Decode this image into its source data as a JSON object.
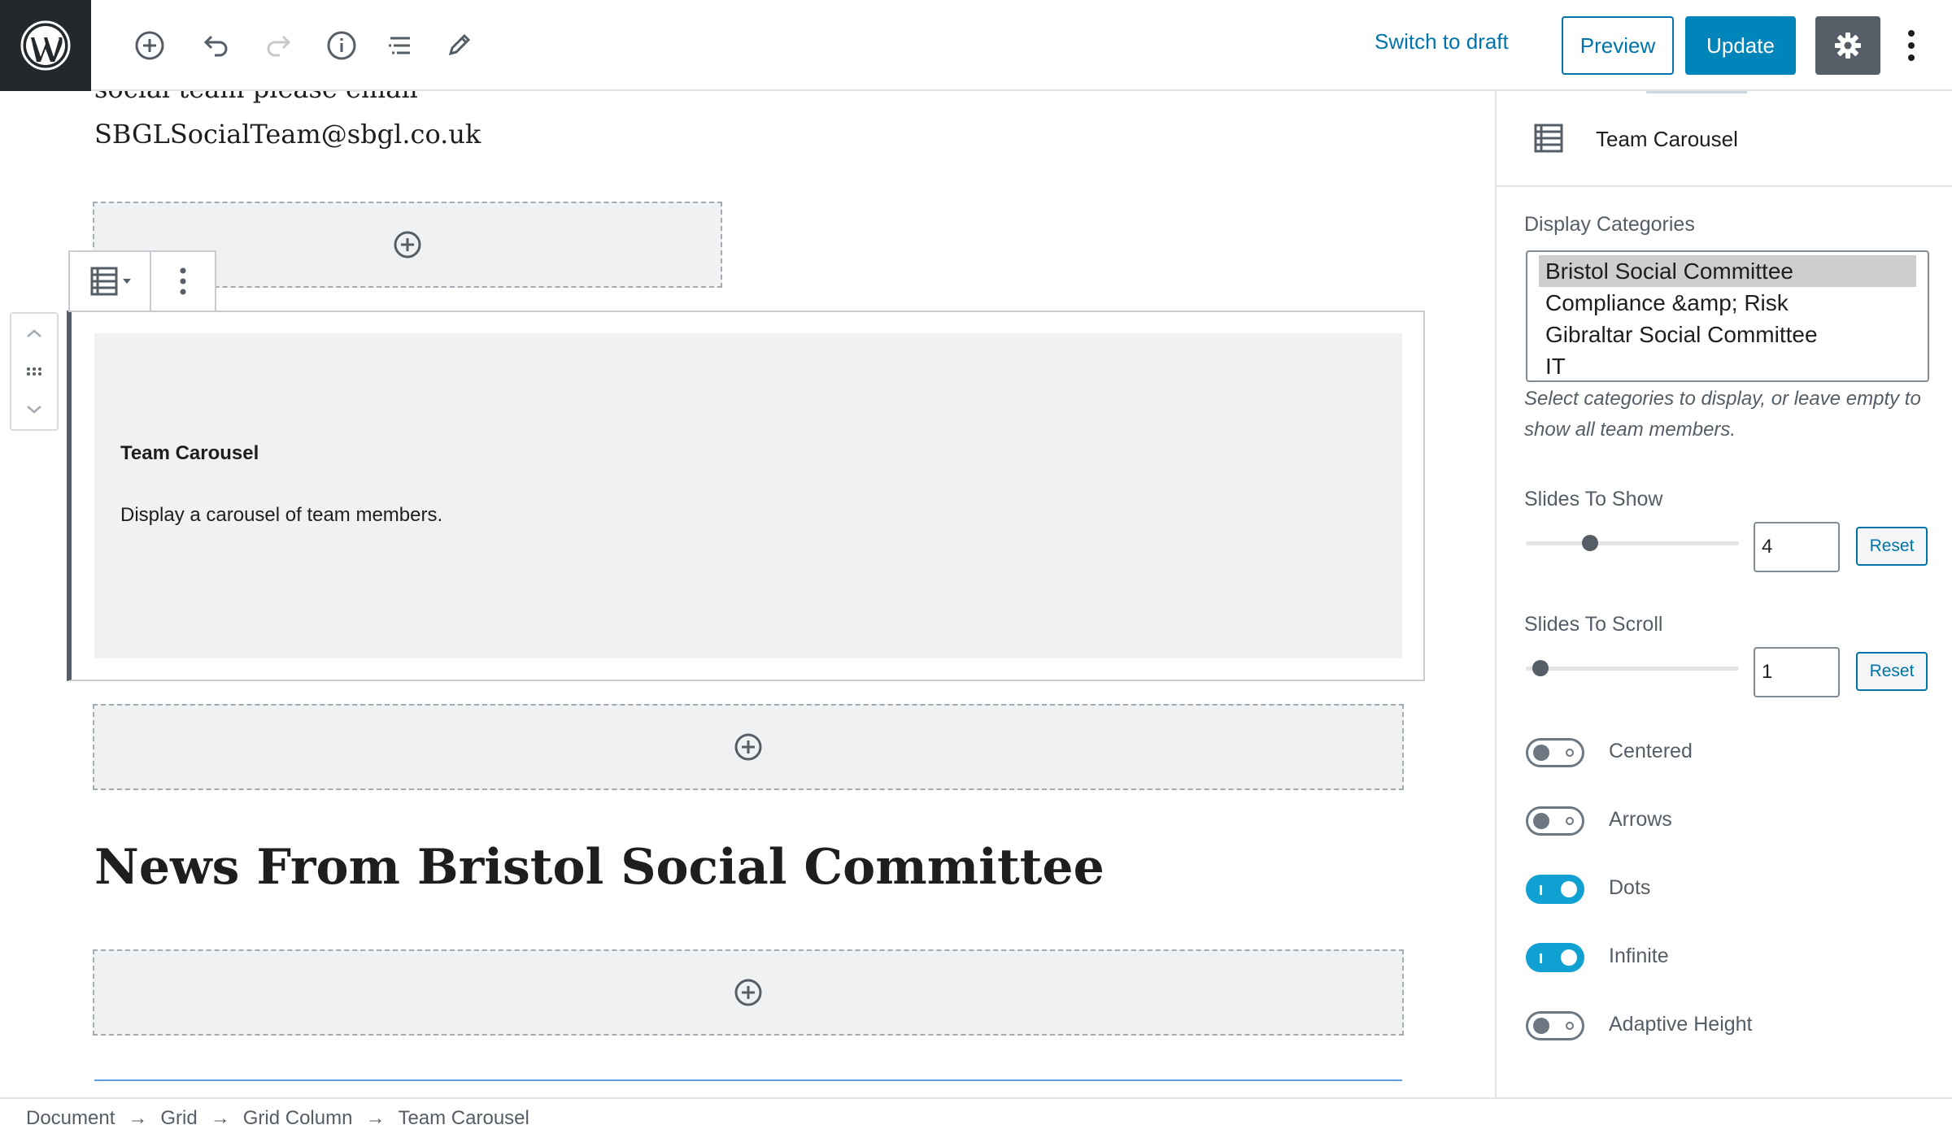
{
  "header": {
    "switch_to_draft": "Switch to draft",
    "preview_label": "Preview",
    "update_label": "Update",
    "icons": [
      "wordpress-logo",
      "add-block-icon",
      "undo-icon",
      "redo-icon",
      "info-icon",
      "outline-icon",
      "edit-icon",
      "gear-icon",
      "more-vertical-icon"
    ]
  },
  "editor": {
    "partial_text": "social team please email",
    "email_text": "SBGLSocialTeam@sbgl.co.uk",
    "block": {
      "title": "Team Carousel",
      "description": "Display a carousel of team members."
    },
    "heading": "News From Bristol Social Committee"
  },
  "sidebar": {
    "block_name": "Team Carousel",
    "display_categories_label": "Display Categories",
    "categories": [
      {
        "label": "Bristol Social Committee",
        "selected": true
      },
      {
        "label": "Compliance &amp; Risk",
        "selected": false
      },
      {
        "label": "Gibraltar Social Committee",
        "selected": false
      },
      {
        "label": "IT",
        "selected": false
      }
    ],
    "categories_help": "Select categories to display, or leave empty to show all team members.",
    "slides_to_show": {
      "label": "Slides To Show",
      "value": "4",
      "reset_label": "Reset",
      "slider_fraction": 0.3
    },
    "slides_to_scroll": {
      "label": "Slides To Scroll",
      "value": "1",
      "reset_label": "Reset",
      "slider_fraction": 0.07
    },
    "toggles": [
      {
        "label": "Centered",
        "on": false
      },
      {
        "label": "Arrows",
        "on": false
      },
      {
        "label": "Dots",
        "on": true
      },
      {
        "label": "Infinite",
        "on": true
      },
      {
        "label": "Adaptive Height",
        "on": false
      }
    ],
    "accent_color": "#11a0d2"
  },
  "breadcrumb": [
    "Document",
    "Grid",
    "Grid Column",
    "Team Carousel"
  ]
}
